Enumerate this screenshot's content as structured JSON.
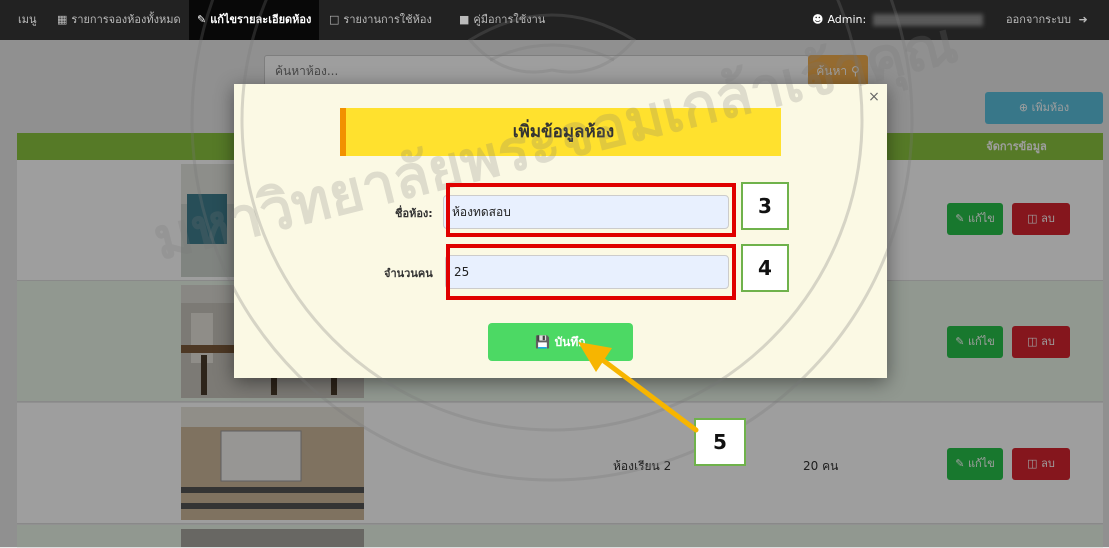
{
  "navbar": {
    "brand": "เมนู",
    "items": [
      {
        "label": "รายการจองห้องทั้งหมด",
        "icon": "table-icon"
      },
      {
        "label": "แก้ไขรายละเอียดห้อง",
        "icon": "edit-icon"
      },
      {
        "label": "รายงานการใช้ห้อง",
        "icon": "document-icon"
      },
      {
        "label": "คู่มือการใช้งาน",
        "icon": "book-icon"
      }
    ],
    "admin_label": "Admin:",
    "logout_label": "ออกจากระบบ"
  },
  "search": {
    "placeholder": "ค้นหาห้อง...",
    "button_label": "ค้นหา"
  },
  "add_room_button": "เพิ่มห้อง",
  "table": {
    "manage_header": "จัดการข้อมูล",
    "rows": [
      {
        "name": "",
        "capacity": "",
        "edit": "แก้ไข",
        "delete": "ลบ"
      },
      {
        "name": "",
        "capacity": "",
        "edit": "แก้ไข",
        "delete": "ลบ"
      },
      {
        "name": "ห้องเรียน 2",
        "capacity": "20 คน",
        "edit": "แก้ไข",
        "delete": "ลบ"
      }
    ]
  },
  "modal": {
    "title": "เพิ่มข้อมูลห้อง",
    "close": "×",
    "room_name_label": "ชื่อห้อง:",
    "room_name_value": "ห้องทดสอบ",
    "capacity_label": "จำนวนคน",
    "capacity_value": "25",
    "save_label": "บันทึก"
  },
  "annotations": {
    "step3": "3",
    "step4": "4",
    "step5": "5"
  },
  "colors": {
    "navbar": "#222222",
    "accent_yellow": "#ffe12e",
    "accent_orange": "#f29100",
    "table_header": "#8cc63f",
    "edit": "#28c24b",
    "delete": "#d7242f",
    "add": "#5bc0de",
    "search": "#f0ad4e",
    "save": "#4cd964",
    "highlight_red": "#e00000",
    "arrow": "#f7b500"
  }
}
